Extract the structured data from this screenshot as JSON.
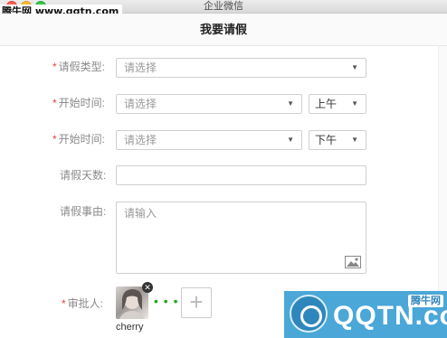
{
  "window": {
    "title": "企业微信"
  },
  "watermark": {
    "top_left": "腾牛网 www.qqtn.com",
    "brand": "QQTN.com",
    "brand_sub": "腾牛网"
  },
  "page": {
    "title": "我要请假"
  },
  "form": {
    "leave_type": {
      "label": "请假类型:",
      "placeholder": "请选择",
      "required": true
    },
    "start_time": {
      "label": "开始时间:",
      "placeholder": "请选择",
      "period": "上午",
      "required": true
    },
    "end_time": {
      "label": "开始时间:",
      "placeholder": "请选择",
      "period": "下午",
      "required": true
    },
    "days": {
      "label": "请假天数:",
      "value": ""
    },
    "reason": {
      "label": "请假事由:",
      "placeholder": "请输入"
    },
    "approver": {
      "label": "审批人:",
      "required": true,
      "name": "cherry"
    }
  },
  "symbols": {
    "required_mark": "*",
    "caret": "▼",
    "remove": "✕",
    "add": "+",
    "dots": "• • •"
  },
  "colors": {
    "required": "#e64340",
    "accent_green": "#1aad19"
  }
}
